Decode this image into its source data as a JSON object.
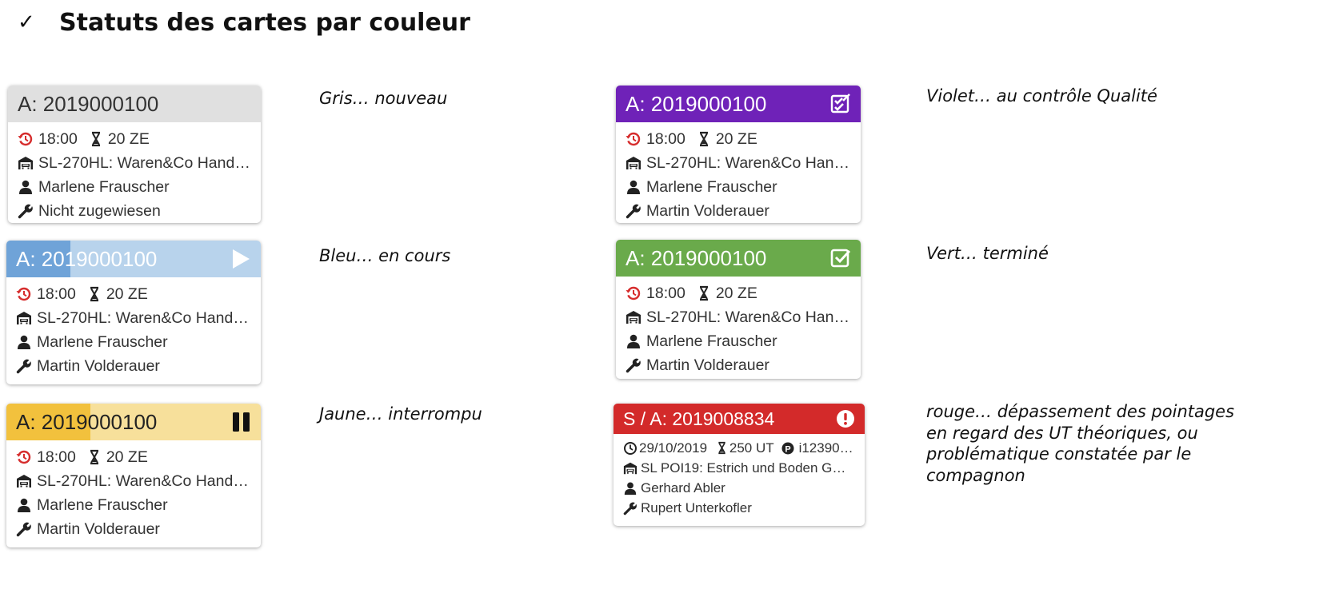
{
  "heading": {
    "check": "✓",
    "title": "Statuts des cartes par couleur"
  },
  "colors": {
    "gray": "#e0e0e0",
    "blue_light": "#b8d3ec",
    "blue_dark": "#6fa3d8",
    "yellow_light": "#f7e09b",
    "yellow_dark": "#f2c13d",
    "purple": "#6f22b8",
    "green": "#6aaa4b",
    "red": "#d32a2a",
    "icon_red": "#d62d2d"
  },
  "cards": {
    "gray": {
      "number": "A: 2019000100",
      "time": "18:00",
      "duration": "20 ZE",
      "vehicle": "SL-270HL: Waren&Co Handels…",
      "person": "Marlene Frauscher",
      "mechanic": "Nicht zugewiesen"
    },
    "blue": {
      "number": "A: 2019000100",
      "progress": 0.25,
      "time": "18:00",
      "duration": "20 ZE",
      "vehicle": "SL-270HL: Waren&Co Handel…",
      "person": "Marlene Frauscher",
      "mechanic": "Martin Volderauer"
    },
    "yellow": {
      "number": "A: 2019000100",
      "progress": 0.33,
      "time": "18:00",
      "duration": "20 ZE",
      "vehicle": "SL-270HL: Waren&Co Handel…",
      "person": "Marlene Frauscher",
      "mechanic": "Martin Volderauer"
    },
    "purple": {
      "number": "A: 2019000100",
      "time": "18:00",
      "duration": "20 ZE",
      "vehicle": "SL-270HL: Waren&Co Handel…",
      "person": "Marlene Frauscher",
      "mechanic": "Martin Volderauer"
    },
    "green": {
      "number": "A: 2019000100",
      "time": "18:00",
      "duration": "20 ZE",
      "vehicle": "SL-270HL: Waren&Co Handel…",
      "person": "Marlene Frauscher",
      "mechanic": "Martin Volderauer"
    },
    "red": {
      "number": "S / A: 2019008834",
      "date": "29/10/2019",
      "duration": "250 UT",
      "ref": "i12390T…",
      "vehicle": "SL POI19: Estrich und Boden GmbH",
      "person": "Gerhard Abler",
      "mechanic": "Rupert Unterkofler"
    }
  },
  "labels": {
    "gray": "Gris… nouveau",
    "blue": "Bleu… en cours",
    "yellow": "Jaune… interrompu",
    "purple": "Violet… au contrôle Qualité",
    "green": "Vert… terminé",
    "red": "rouge… dépassement des pointages en regard des UT théoriques, ou problématique constatée par le compagnon"
  }
}
